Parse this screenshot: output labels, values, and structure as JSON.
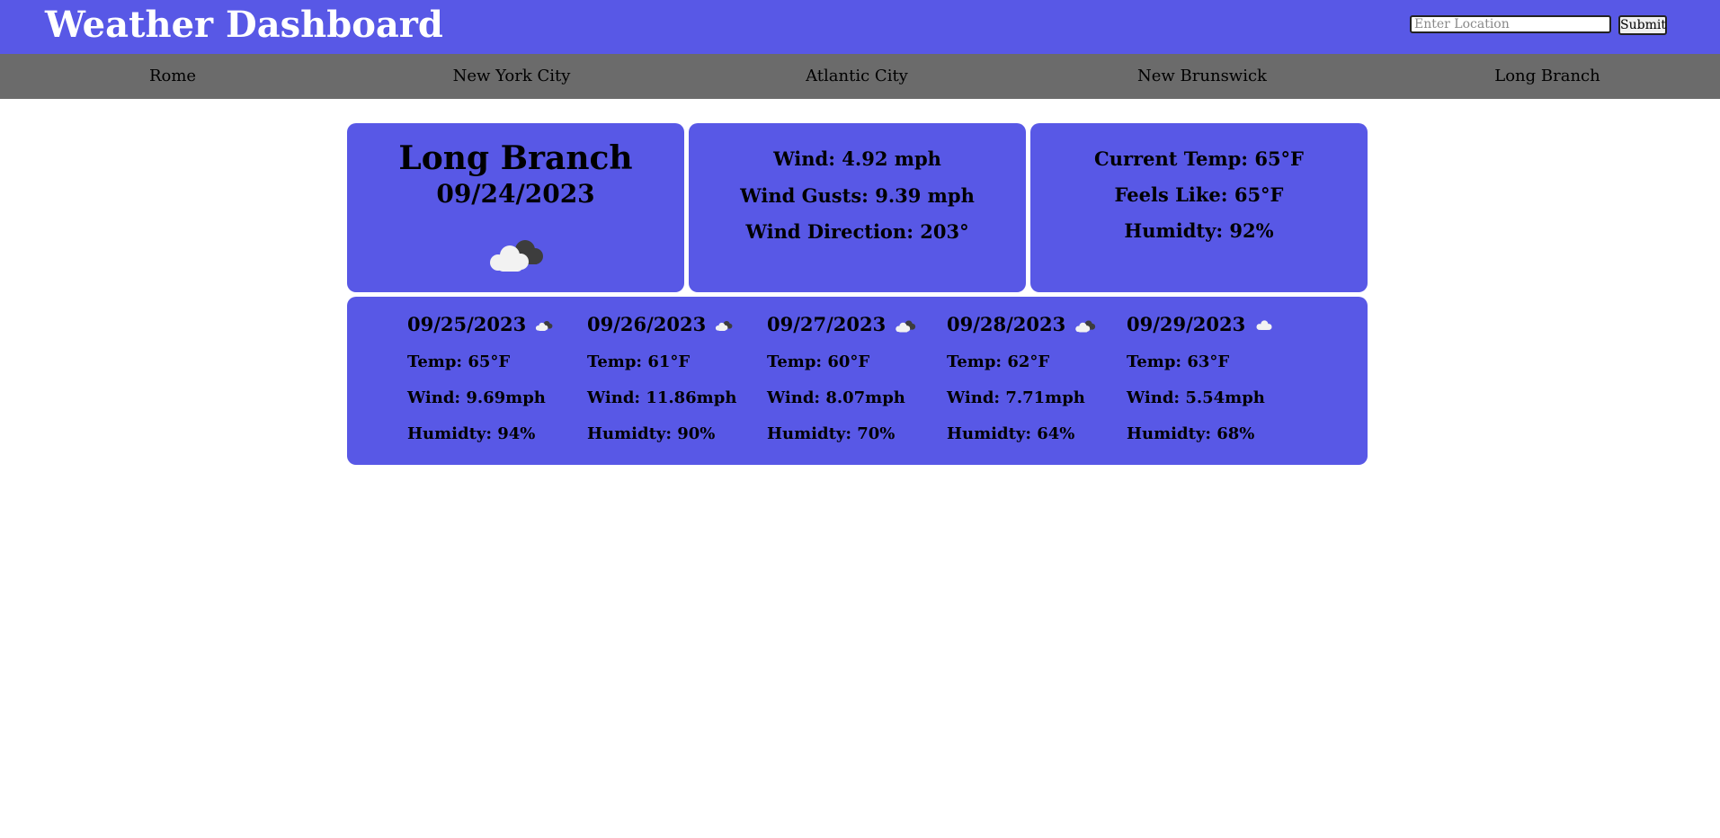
{
  "header": {
    "title": "Weather Dashboard",
    "search_placeholder": "Enter Location",
    "search_value": "",
    "submit_label": "Submit"
  },
  "nav": {
    "cities": [
      "Rome",
      "New York City",
      "Atlantic City",
      "New Brunswick",
      "Long Branch"
    ]
  },
  "current": {
    "city": "Long Branch",
    "date": "09/24/2023",
    "icon": "cloudy-icon",
    "wind": "Wind: 4.92 mph",
    "wind_gusts": "Wind Gusts: 9.39 mph",
    "wind_direction": "Wind Direction: 203°",
    "current_temp": "Current Temp: 65°F",
    "feels_like": "Feels Like: 65°F",
    "humidity": "Humidty: 92%"
  },
  "forecast": [
    {
      "date": "09/25/2023",
      "icon": "cloudy-icon",
      "temp": "Temp: 65°F",
      "wind": "Wind: 9.69mph",
      "humidity": "Humidty: 94%"
    },
    {
      "date": "09/26/2023",
      "icon": "cloudy-icon",
      "temp": "Temp: 61°F",
      "wind": "Wind: 11.86mph",
      "humidity": "Humidty: 90%"
    },
    {
      "date": "09/27/2023",
      "icon": "cloudy-icon",
      "temp": "Temp: 60°F",
      "wind": "Wind: 8.07mph",
      "humidity": "Humidty: 70%"
    },
    {
      "date": "09/28/2023",
      "icon": "cloudy-icon",
      "temp": "Temp: 62°F",
      "wind": "Wind: 7.71mph",
      "humidity": "Humidty: 64%"
    },
    {
      "date": "09/29/2023",
      "icon": "cloudy-icon",
      "temp": "Temp: 63°F",
      "wind": "Wind: 5.54mph",
      "humidity": "Humidty: 68%"
    }
  ],
  "colors": {
    "primary": "#5858e6",
    "nav_background": "#6b6b6b",
    "title_text": "#ffffff"
  }
}
